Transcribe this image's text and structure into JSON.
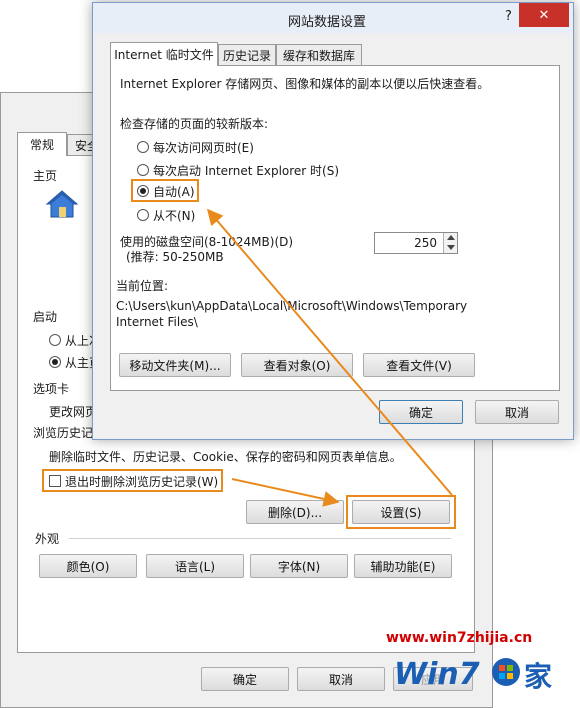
{
  "internet_options": {
    "tabs": [
      "常规",
      "安全"
    ],
    "homepage_label": "主页",
    "startup_label": "启动",
    "startup_options": [
      "从上次",
      "从主页"
    ],
    "tabs_section_label": "选项卡",
    "tabs_desc": "更改网页",
    "history_section_label": "浏览历史记",
    "history_desc": "删除临时文件、历史记录、Cookie、保存的密码和网页表单信息。",
    "delete_on_exit": "退出时删除浏览历史记录(W)",
    "delete_button": "删除(D)...",
    "settings_button": "设置(S)",
    "appearance_label": "外观",
    "appearance_buttons": [
      "颜色(O)",
      "语言(L)",
      "字体(N)",
      "辅助功能(E)"
    ],
    "ok_button": "确定",
    "cancel_button": "取消",
    "apply_button": "应用"
  },
  "website_data_settings": {
    "title": "网站数据设置",
    "help_button": "?",
    "close_button": "✕",
    "tabs": [
      "Internet 临时文件",
      "历史记录",
      "缓存和数据库"
    ],
    "intro": "Internet Explorer 存储网页、图像和媒体的副本以便以后快速查看。",
    "check_label": "检查存储的页面的较新版本:",
    "check_options": [
      "每次访问网页时(E)",
      "每次启动 Internet Explorer 时(S)",
      "自动(A)",
      "从不(N)"
    ],
    "selected_option": "自动(A)",
    "disk_space_label": "使用的磁盘空间(8-1024MB)(D)",
    "disk_space_recommend": "(推荐: 50-250MB",
    "disk_space_value": "250",
    "current_location_label": "当前位置:",
    "current_location_path_1": "C:\\Users\\kun\\AppData\\Local\\Microsoft\\Windows\\Temporary",
    "current_location_path_2": "Internet Files\\",
    "move_folder_button": "移动文件夹(M)...",
    "view_objects_button": "查看对象(O)",
    "view_files_button": "查看文件(V)",
    "ok_button": "确定",
    "cancel_button": "取消"
  },
  "watermark": {
    "url": "www.win7zhijia.cn",
    "logo_text": "Win7之家"
  },
  "colors": {
    "highlight": "#e98a1c",
    "watermark_red": "#d20000",
    "logo_blue": "#1a5fb4"
  }
}
